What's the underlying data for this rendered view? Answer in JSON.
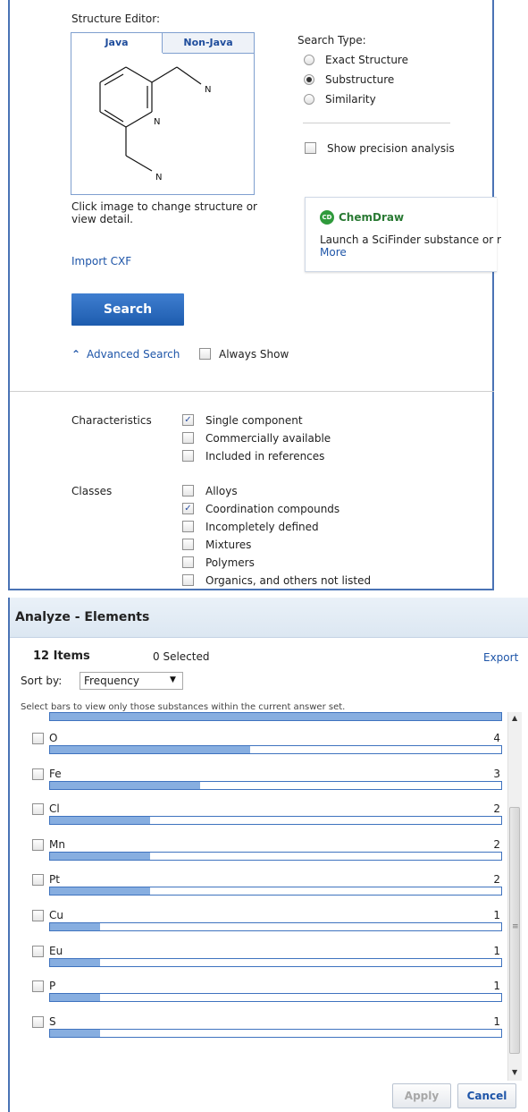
{
  "structure_editor": {
    "label": "Structure Editor:",
    "tabs": [
      "Java",
      "Non-Java"
    ],
    "atoms": [
      "N",
      "N",
      "N"
    ],
    "hint": "Click image to change structure or view detail.",
    "import_label": "Import CXF"
  },
  "search_type": {
    "label": "Search Type:",
    "options": [
      {
        "label": "Exact Structure",
        "selected": false
      },
      {
        "label": "Substructure",
        "selected": true
      },
      {
        "label": "Similarity",
        "selected": false
      }
    ],
    "precision_label": "Show precision analysis"
  },
  "chemdraw": {
    "logo_text": "ChemDraw",
    "logo_mark": "CD",
    "text": "Launch a SciFinder substance or r",
    "more_link": "More"
  },
  "search_button": "Search",
  "advanced_search": {
    "link": "Advanced Search",
    "always_show": "Always Show"
  },
  "characteristics": {
    "label": "Characteristics",
    "items": [
      {
        "label": "Single component",
        "checked": true
      },
      {
        "label": "Commercially available",
        "checked": false
      },
      {
        "label": "Included in references",
        "checked": false
      }
    ]
  },
  "classes": {
    "label": "Classes",
    "items": [
      {
        "label": "Alloys",
        "checked": false
      },
      {
        "label": "Coordination compounds",
        "checked": true
      },
      {
        "label": "Incompletely defined",
        "checked": false
      },
      {
        "label": "Mixtures",
        "checked": false
      },
      {
        "label": "Polymers",
        "checked": false
      },
      {
        "label": "Organics, and others not listed",
        "checked": false
      }
    ]
  },
  "analyze": {
    "title": "Analyze - Elements",
    "items_count": "12 Items",
    "selected_count": "0 Selected",
    "export_link": "Export",
    "sort_label": "Sort by:",
    "sort_value": "Frequency",
    "instruction": "Select bars to view only those substances within the current answer set.",
    "top_bar_fraction": 1.0,
    "max_count": 9,
    "elements": [
      {
        "symbol": "O",
        "count": 4
      },
      {
        "symbol": "Fe",
        "count": 3
      },
      {
        "symbol": "Cl",
        "count": 2
      },
      {
        "symbol": "Mn",
        "count": 2
      },
      {
        "symbol": "Pt",
        "count": 2
      },
      {
        "symbol": "Cu",
        "count": 1
      },
      {
        "symbol": "Eu",
        "count": 1
      },
      {
        "symbol": "P",
        "count": 1
      },
      {
        "symbol": "S",
        "count": 1
      }
    ],
    "apply_button": "Apply",
    "cancel_button": "Cancel"
  },
  "colors": {
    "accent": "#1e55a8",
    "bar_fill": "#87aee0",
    "bar_border": "#3f73bf",
    "panel_border": "#4a73b5"
  }
}
